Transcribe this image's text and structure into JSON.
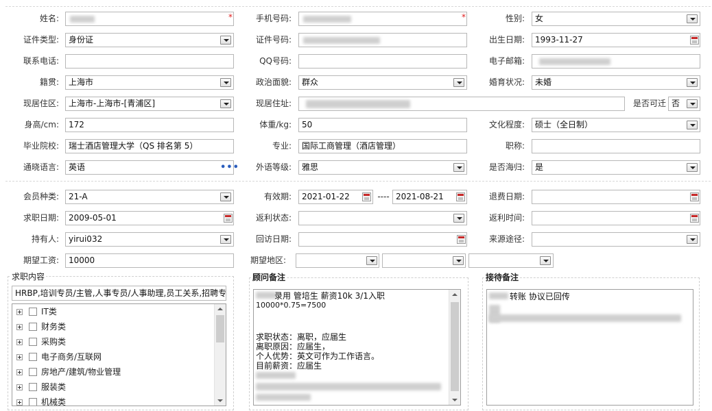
{
  "form": {
    "name": {
      "label": "姓名:"
    },
    "mobile": {
      "label": "手机号码:"
    },
    "gender": {
      "label": "性别:",
      "value": "女"
    },
    "id_type": {
      "label": "证件类型:",
      "value": "身份证"
    },
    "id_number": {
      "label": "证件号码:"
    },
    "birth_date": {
      "label": "出生日期:",
      "value": "1993-11-27"
    },
    "phone": {
      "label": "联系电话:",
      "value": ""
    },
    "qq": {
      "label": "QQ号码:",
      "value": ""
    },
    "email": {
      "label": "电子邮箱:"
    },
    "native_place": {
      "label": "籍贯:",
      "value": "上海市"
    },
    "political_status": {
      "label": "政治面貌:",
      "value": "群众"
    },
    "marital_status": {
      "label": "婚育状况:",
      "value": "未婚"
    },
    "residence_area": {
      "label": "现居住区:",
      "value": "上海市-上海市-[青浦区]"
    },
    "residence_address": {
      "label": "现居住址:"
    },
    "relocatable": {
      "label": "是否可迁",
      "value": "否"
    },
    "height": {
      "label": "身高/cm:",
      "value": "172"
    },
    "weight": {
      "label": "体重/kg:",
      "value": "50"
    },
    "education": {
      "label": "文化程度:",
      "value": "硕士（全日制）"
    },
    "school": {
      "label": "毕业院校:",
      "value": "瑞士酒店管理大学（QS 排名第 5）"
    },
    "major": {
      "label": "专业:",
      "value": "国际工商管理（酒店管理）"
    },
    "title": {
      "label": "职称:",
      "value": ""
    },
    "language": {
      "label": "通晓语言:",
      "value": "英语",
      "more": "•••"
    },
    "language_level": {
      "label": "外语等级:",
      "value": "雅思"
    },
    "overseas": {
      "label": "是否海归:",
      "value": "是"
    },
    "member_type": {
      "label": "会员种类:",
      "value": "21-A"
    },
    "validity": {
      "label": "有效期:",
      "start": "2021-01-22",
      "sep": "----",
      "end": "2021-08-21"
    },
    "refund_date": {
      "label": "退费日期:",
      "value": ""
    },
    "apply_date": {
      "label": "求职日期:",
      "value": "2009-05-01"
    },
    "rebate_status": {
      "label": "返利状态:",
      "value": ""
    },
    "rebate_time": {
      "label": "返利时间:",
      "value": ""
    },
    "holder": {
      "label": "持有人:",
      "value": "yirui032"
    },
    "visit_date": {
      "label": "回访日期:",
      "value": ""
    },
    "source": {
      "label": "来源途径:",
      "value": ""
    },
    "expected_salary": {
      "label": "期望工资:",
      "value": "10000"
    },
    "expected_region": {
      "label": "期望地区:"
    }
  },
  "job_content": {
    "legend": "求职内容",
    "summary": "HRBP,培训专员/主管,人事专员/人事助理,员工关系,招聘专",
    "tree": [
      {
        "label": "IT类"
      },
      {
        "label": "财务类"
      },
      {
        "label": "采购类"
      },
      {
        "label": "电子商务/互联网"
      },
      {
        "label": "房地产/建筑/物业管理"
      },
      {
        "label": "服装类"
      },
      {
        "label": "机械类"
      }
    ]
  },
  "advisor_notes": {
    "legend": "顾问备注",
    "lines": [
      "录用  管培生  薪资10k  3/1入职",
      "10000*0.75=7500",
      "",
      "",
      "求职状态：离职，应届生",
      "离职原因：应届生，",
      "个人优势：英文可作为工作语言。",
      "目前薪资：应届生"
    ]
  },
  "reception_notes": {
    "legend": "接待备注",
    "line1": "转账 协议已回传"
  },
  "colors": {
    "required": "#e02020",
    "more_dots": "#2a5dbd",
    "border": "#b7b7b7"
  }
}
